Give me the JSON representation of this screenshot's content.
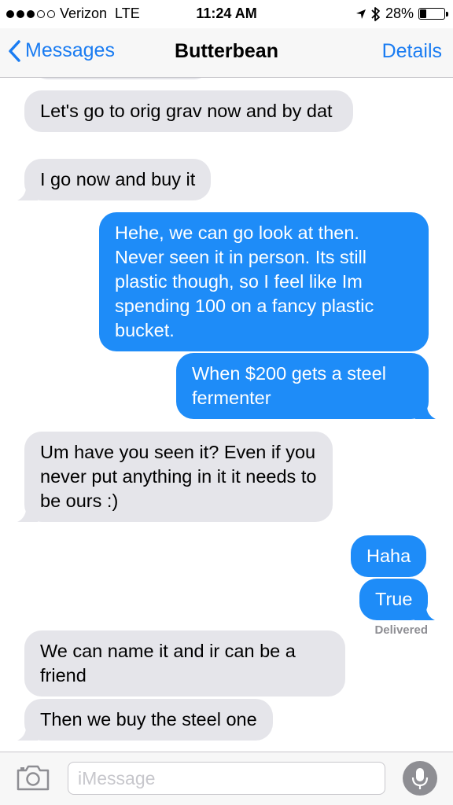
{
  "status_bar": {
    "carrier": "Verizon",
    "network": "LTE",
    "time": "11:24 AM",
    "battery_percent": "28%",
    "battery_level": 0.28,
    "signal_dots_filled": 3,
    "signal_dots_total": 5
  },
  "nav": {
    "back_label": "Messages",
    "title": "Butterbean",
    "details_label": "Details"
  },
  "messages": [
    {
      "direction": "in",
      "text": "Let's go to orig grav now and by dat"
    },
    {
      "direction": "in",
      "text": "I go now and buy it"
    },
    {
      "direction": "out",
      "text": "Hehe, we can go look at then. Never seen it in person.  Its still plastic though, so I feel like Im spending 100 on a fancy plastic bucket."
    },
    {
      "direction": "out",
      "text": "When $200 gets a steel fermenter"
    },
    {
      "direction": "in",
      "text": "Um have you seen it?  Even if you never put anything in it it needs to be ours :)"
    },
    {
      "direction": "out",
      "text": "Haha"
    },
    {
      "direction": "out",
      "text": "True"
    },
    {
      "direction": "in",
      "text": "We can name it and ir can be a friend"
    },
    {
      "direction": "in",
      "text": "Then we buy the steel one"
    }
  ],
  "delivered_label": "Delivered",
  "input": {
    "placeholder": "iMessage",
    "value": ""
  },
  "icons": {
    "back": "chevron-left-icon",
    "camera": "camera-icon",
    "mic": "microphone-icon",
    "location": "location-arrow-icon",
    "bluetooth": "bluetooth-icon",
    "battery": "battery-icon"
  },
  "colors": {
    "accent": "#1a7cf2",
    "outgoing_bubble": "#1e8cf8",
    "incoming_bubble": "#e5e5ea",
    "muted": "#8e8e93"
  }
}
